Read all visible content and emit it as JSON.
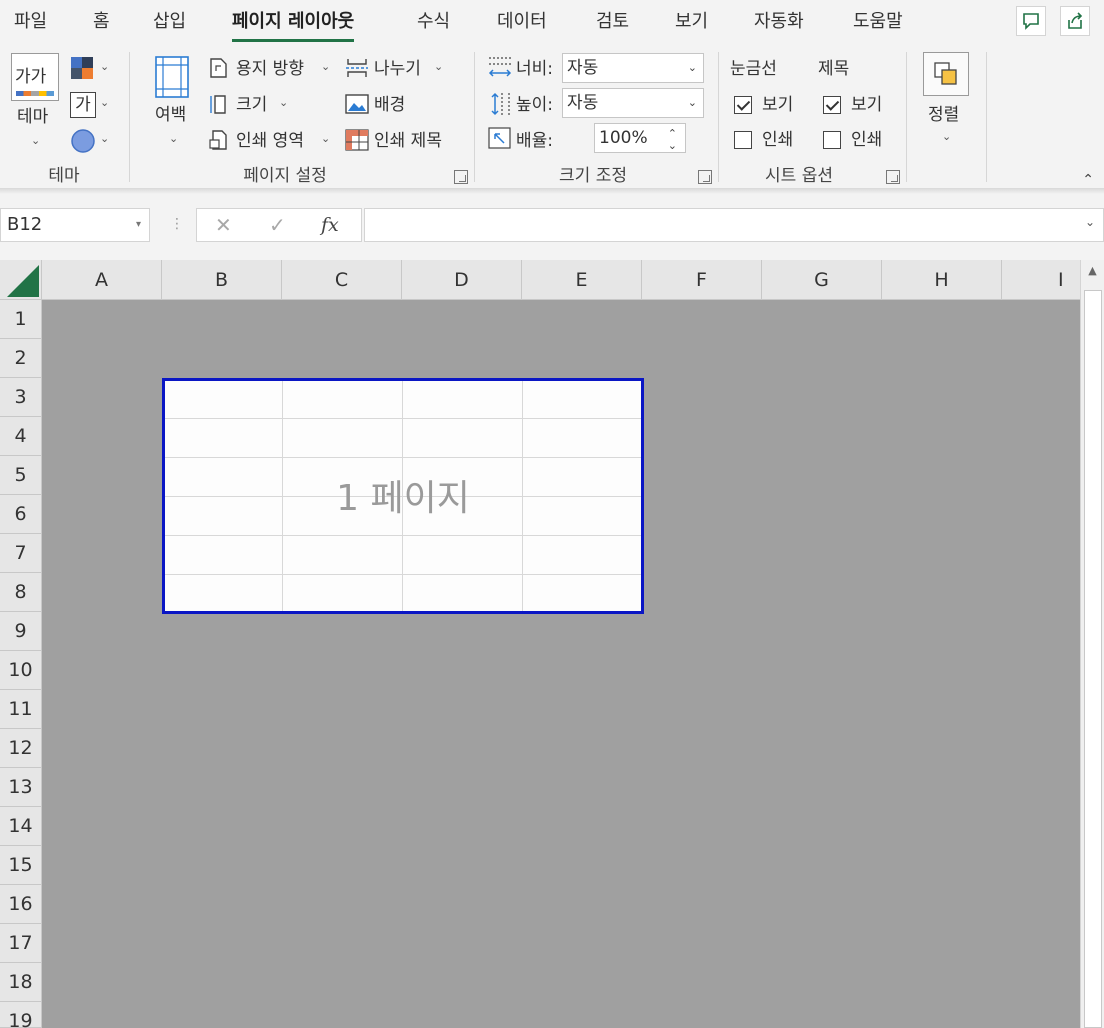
{
  "tabs": [
    {
      "label": "파일",
      "active": false
    },
    {
      "label": "홈",
      "active": false
    },
    {
      "label": "삽입",
      "active": false
    },
    {
      "label": "페이지 레이아웃",
      "active": true
    },
    {
      "label": "수식",
      "active": false
    },
    {
      "label": "데이터",
      "active": false
    },
    {
      "label": "검토",
      "active": false
    },
    {
      "label": "보기",
      "active": false
    },
    {
      "label": "자동화",
      "active": false
    },
    {
      "label": "도움말",
      "active": false
    }
  ],
  "theme": {
    "group_label": "테마",
    "theme_button_label": "테마",
    "font_glyph": "가",
    "theme_preview_glyph": "가가"
  },
  "page_setup": {
    "group_label": "페이지 설정",
    "margins_label": "여백",
    "orientation_label": "용지 방향",
    "size_label": "크기",
    "print_area_label": "인쇄 영역",
    "breaks_label": "나누기",
    "background_label": "배경",
    "print_titles_label": "인쇄 제목"
  },
  "scale_to_fit": {
    "group_label": "크기 조정",
    "width_label": "너비:",
    "width_value": "자동",
    "height_label": "높이:",
    "height_value": "자동",
    "scale_label": "배율:",
    "scale_value": "100%"
  },
  "sheet_options": {
    "group_label": "시트 옵션",
    "gridlines_label": "눈금선",
    "headings_label": "제목",
    "view_label": "보기",
    "print_label": "인쇄",
    "gridlines_view": true,
    "gridlines_print": false,
    "headings_view": true,
    "headings_print": false
  },
  "arrange": {
    "label": "정렬"
  },
  "formula_bar": {
    "name_box": "B12",
    "fx_label": "fx",
    "cancel_glyph": "✕",
    "enter_glyph": "✓",
    "formula": ""
  },
  "columns": [
    "A",
    "B",
    "C",
    "D",
    "E",
    "F",
    "G",
    "H",
    "I"
  ],
  "rows": [
    "1",
    "2",
    "3",
    "4",
    "5",
    "6",
    "7",
    "8",
    "9",
    "10",
    "11",
    "12",
    "13",
    "14",
    "15",
    "16",
    "17",
    "18",
    "19"
  ],
  "page_preview": {
    "label": "1 페이지",
    "border_color": "#0a16c4"
  },
  "colors": {
    "accent": "#217346",
    "page_break_background": "#a0a0a0"
  }
}
